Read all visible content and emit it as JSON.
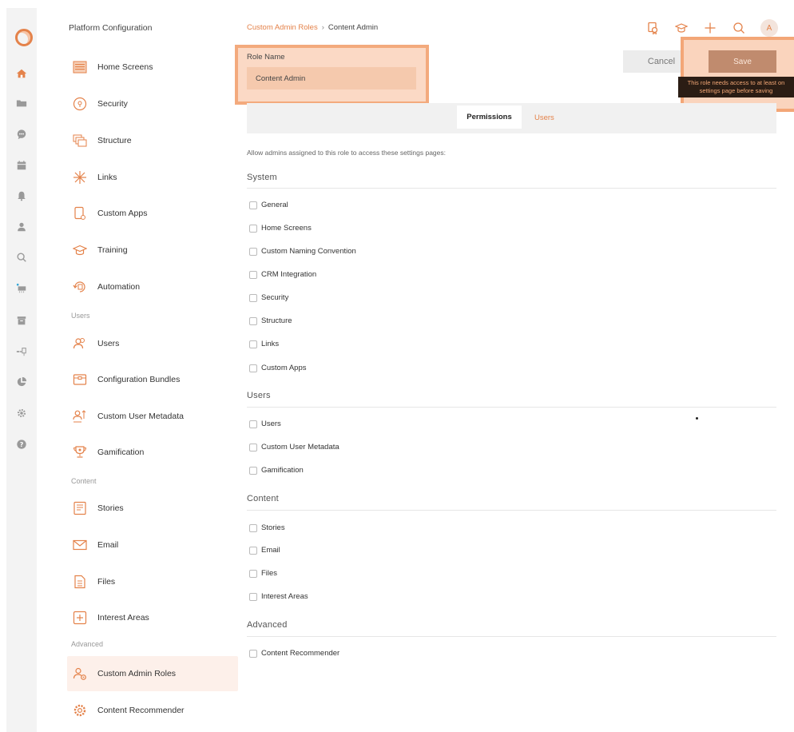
{
  "sidebar": {
    "title": "Platform Configuration",
    "items": [
      {
        "label": "Home Screens",
        "icon": "home-screens-icon"
      },
      {
        "label": "Security",
        "icon": "security-icon"
      },
      {
        "label": "Structure",
        "icon": "structure-icon"
      },
      {
        "label": "Links",
        "icon": "links-icon"
      },
      {
        "label": "Custom Apps",
        "icon": "custom-apps-icon"
      },
      {
        "label": "Training",
        "icon": "training-icon"
      },
      {
        "label": "Automation",
        "icon": "automation-icon"
      },
      {
        "label": "Users",
        "icon": "users-icon"
      },
      {
        "label": "Configuration Bundles",
        "icon": "bundles-icon"
      },
      {
        "label": "Custom User Metadata",
        "icon": "metadata-icon"
      },
      {
        "label": "Gamification",
        "icon": "trophy-icon"
      },
      {
        "label": "Stories",
        "icon": "stories-icon"
      },
      {
        "label": "Email",
        "icon": "email-icon"
      },
      {
        "label": "Files",
        "icon": "files-icon"
      },
      {
        "label": "Interest Areas",
        "icon": "interest-areas-icon"
      },
      {
        "label": "Custom Admin Roles",
        "icon": "admin-roles-icon"
      },
      {
        "label": "Content Recommender",
        "icon": "recommender-icon"
      }
    ],
    "sections": {
      "users": "Users",
      "content": "Content",
      "advanced": "Advanced"
    }
  },
  "breadcrumb": {
    "parent": "Custom Admin Roles",
    "separator": "›",
    "current": "Content Admin"
  },
  "header": {
    "avatar_initial": "A"
  },
  "role": {
    "label": "Role Name",
    "value": "Content Admin"
  },
  "actions": {
    "cancel_label": "Cancel",
    "save_label": "Save",
    "tooltip_line1": "This role needs access to at least on",
    "tooltip_line2": "settings page before saving"
  },
  "tabs": [
    {
      "label": "Permissions",
      "active": true
    },
    {
      "label": "Users",
      "active": false
    }
  ],
  "permissions": {
    "description": "Allow admins assigned to this role to access these settings pages:",
    "groups": [
      {
        "title": "System",
        "items": [
          "General",
          "Home Screens",
          "Custom Naming Convention",
          "CRM Integration",
          "Security",
          "Structure",
          "Links",
          "Custom Apps"
        ]
      },
      {
        "title": "Users",
        "items": [
          "Users",
          "Custom User Metadata",
          "Gamification"
        ]
      },
      {
        "title": "Content",
        "items": [
          "Stories",
          "Email",
          "Files",
          "Interest Areas"
        ]
      },
      {
        "title": "Advanced",
        "items": [
          "Content Recommender"
        ]
      }
    ]
  },
  "colors": {
    "accent": "#e4824a",
    "highlight": "#f3a677",
    "tooltip_bg": "#2b1d14"
  }
}
